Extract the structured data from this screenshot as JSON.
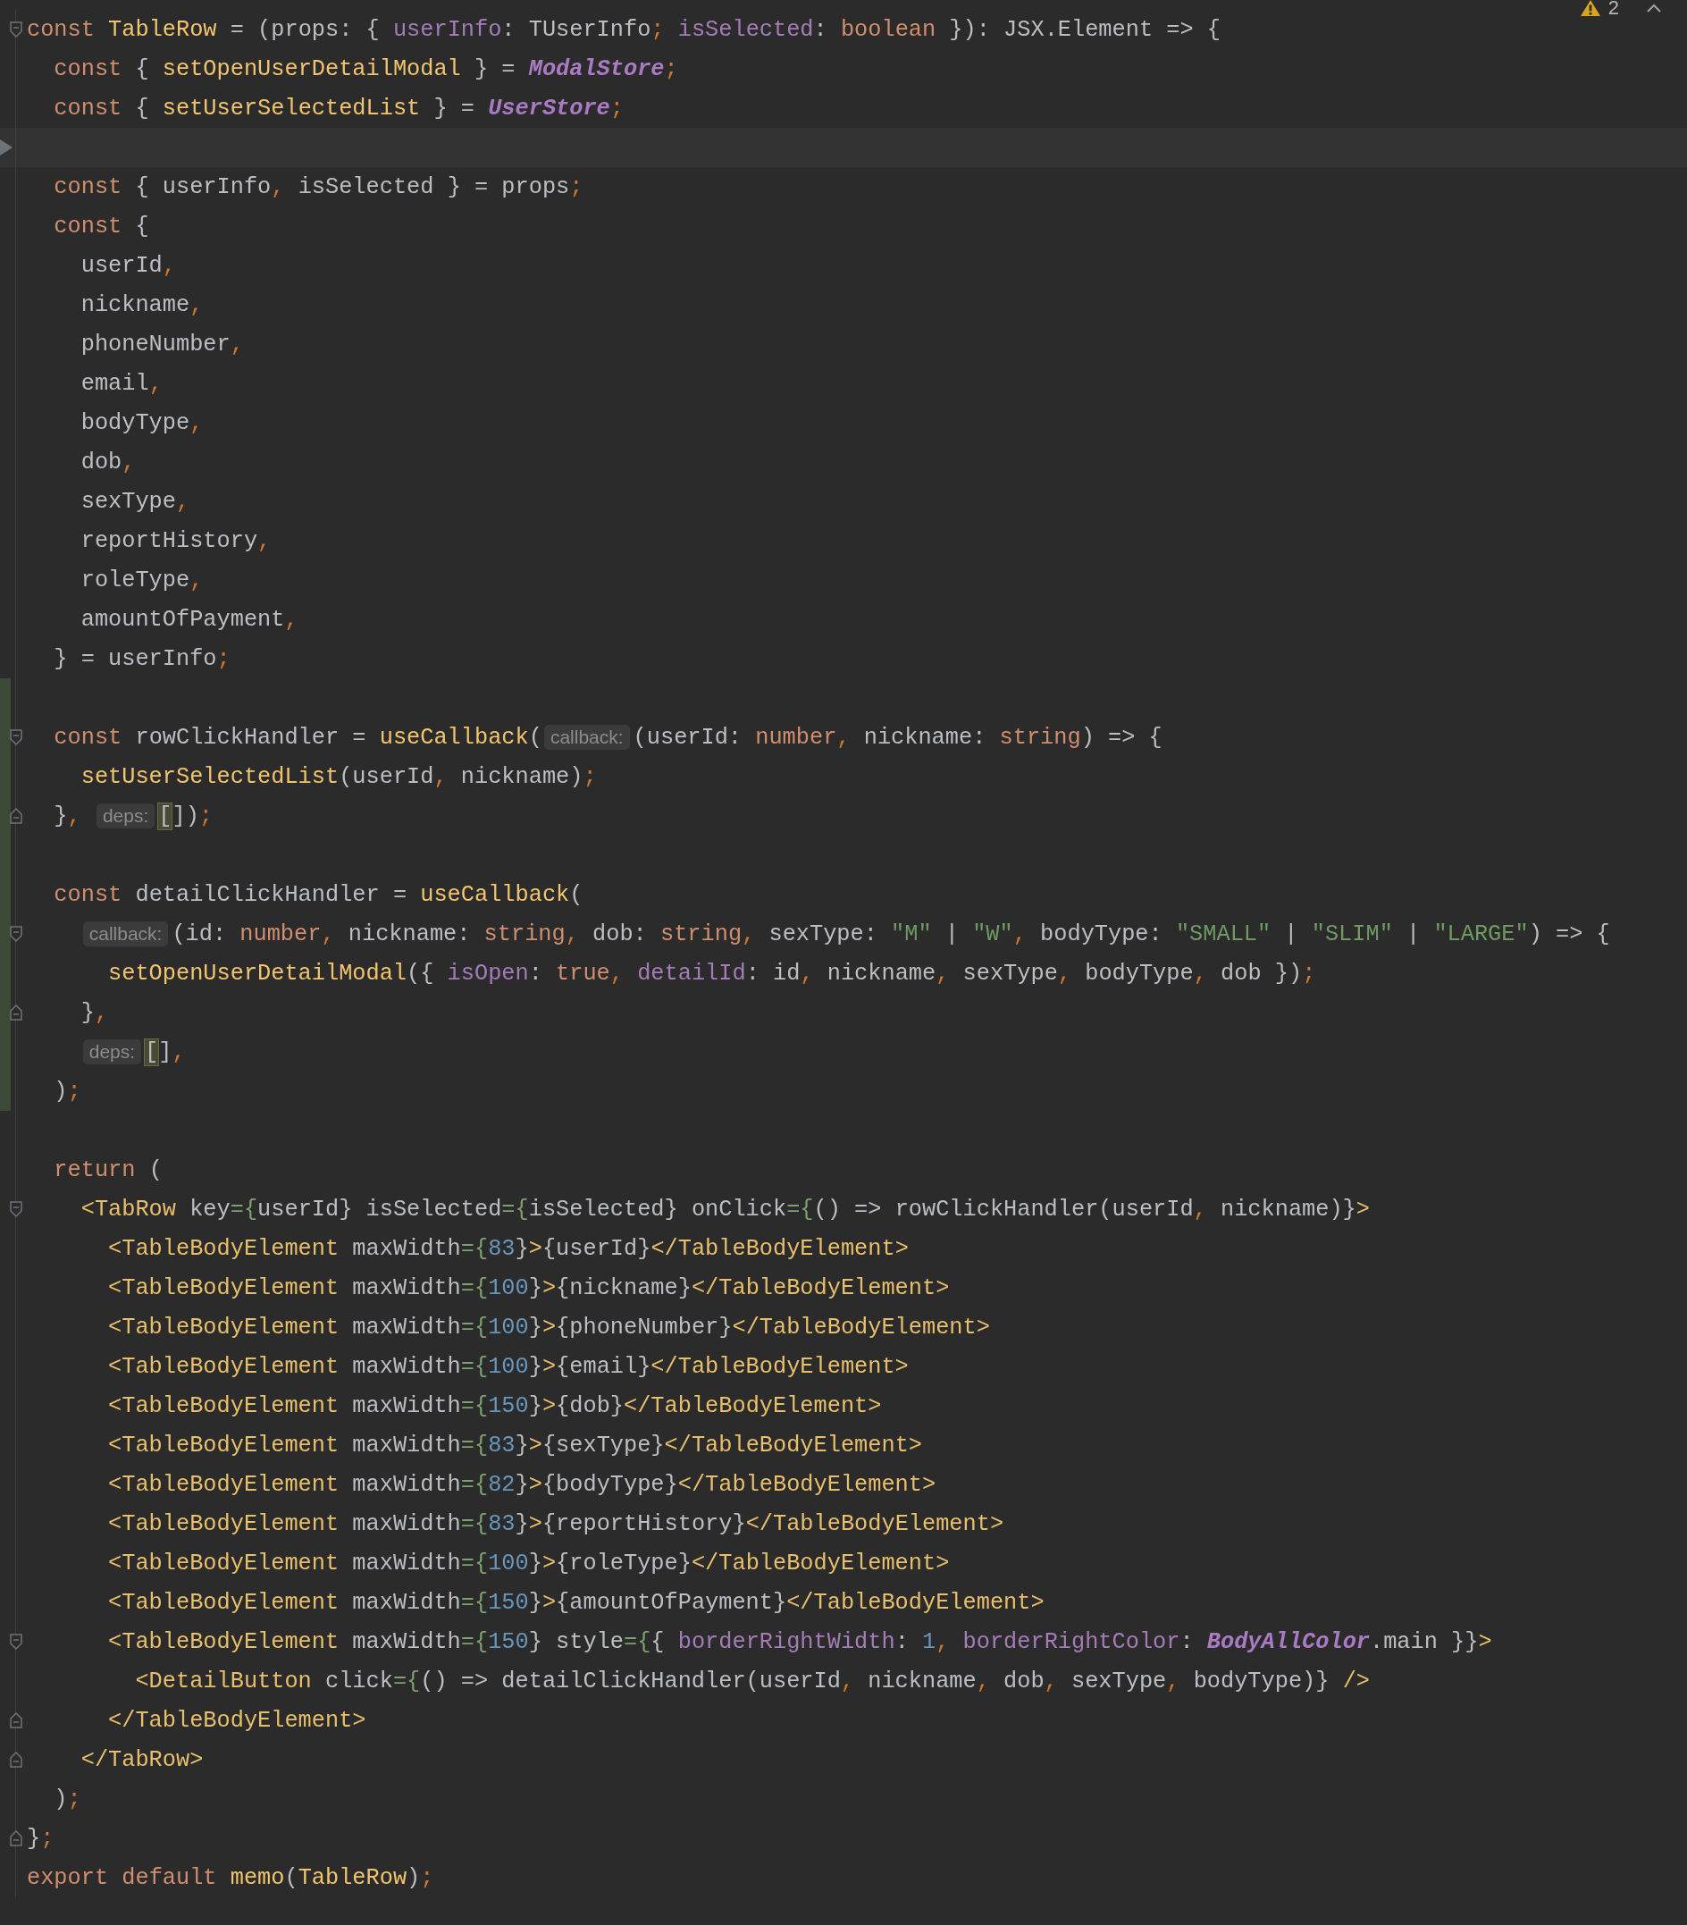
{
  "inspections": {
    "warning_count": "2"
  },
  "lines": [
    {
      "kind": "open",
      "current": false,
      "modified": false,
      "tokens": [
        {
          "kind": "keyword",
          "text": "const "
        },
        {
          "kind": "call",
          "text": "TableRow"
        },
        {
          "kind": "plain",
          "text": " = (props: { "
        },
        {
          "kind": "field",
          "text": "userInfo"
        },
        {
          "kind": "plain",
          "text": ": TUserInfo"
        },
        {
          "kind": "punct",
          "text": "; "
        },
        {
          "kind": "field",
          "text": "isSelected"
        },
        {
          "kind": "plain",
          "text": ": "
        },
        {
          "kind": "keyword",
          "text": "boolean"
        },
        {
          "kind": "plain",
          "text": " }): JSX.Element => {"
        }
      ],
      "children": [
        {
          "current": false,
          "modified": false,
          "tokens": [
            {
              "kind": "keyword",
              "text": "const "
            },
            {
              "kind": "plain",
              "text": "{ "
            },
            {
              "kind": "call",
              "text": "setOpenUserDetailModal"
            },
            {
              "kind": "plain",
              "text": " } = "
            },
            {
              "kind": "static",
              "text": "ModalStore"
            },
            {
              "kind": "punct",
              "text": ";"
            }
          ]
        },
        {
          "current": false,
          "modified": false,
          "tokens": [
            {
              "kind": "keyword",
              "text": "const "
            },
            {
              "kind": "plain",
              "text": "{ "
            },
            {
              "kind": "call",
              "text": "setUserSelectedList"
            },
            {
              "kind": "plain",
              "text": " } = "
            },
            {
              "kind": "static",
              "text": "UserStore"
            },
            {
              "kind": "punct",
              "text": ";"
            }
          ]
        },
        {
          "current": true,
          "modified": false
        },
        {
          "current": false,
          "modified": false,
          "tokens": [
            {
              "kind": "keyword",
              "text": "const "
            },
            {
              "kind": "plain",
              "text": "{ userInfo"
            },
            {
              "kind": "punct",
              "text": ", "
            },
            {
              "kind": "plain",
              "text": "isSelected } = props"
            },
            {
              "kind": "punct",
              "text": ";"
            }
          ]
        },
        {
          "current": false,
          "modified": false,
          "tokens": [
            {
              "kind": "keyword",
              "text": "const "
            },
            {
              "kind": "plain",
              "text": "{"
            }
          ],
          "children": [
            {
              "current": false,
              "modified": false,
              "tokens": [
                {
                  "kind": "plain",
                  "text": "userId"
                },
                {
                  "kind": "punct",
                  "text": ","
                }
              ]
            },
            {
              "current": false,
              "modified": false,
              "tokens": [
                {
                  "kind": "plain",
                  "text": "nickname"
                },
                {
                  "kind": "punct",
                  "text": ","
                }
              ]
            },
            {
              "current": false,
              "modified": false,
              "tokens": [
                {
                  "kind": "plain",
                  "text": "phoneNumber"
                },
                {
                  "kind": "punct",
                  "text": ","
                }
              ]
            },
            {
              "current": false,
              "modified": false,
              "tokens": [
                {
                  "kind": "plain",
                  "text": "email"
                },
                {
                  "kind": "punct",
                  "text": ","
                }
              ]
            },
            {
              "current": false,
              "modified": false,
              "tokens": [
                {
                  "kind": "plain",
                  "text": "bodyType"
                },
                {
                  "kind": "punct",
                  "text": ","
                }
              ]
            },
            {
              "current": false,
              "modified": false,
              "tokens": [
                {
                  "kind": "plain",
                  "text": "dob"
                },
                {
                  "kind": "punct",
                  "text": ","
                }
              ]
            },
            {
              "current": false,
              "modified": false,
              "tokens": [
                {
                  "kind": "plain",
                  "text": "sexType"
                },
                {
                  "kind": "punct",
                  "text": ","
                }
              ]
            },
            {
              "current": false,
              "modified": false,
              "tokens": [
                {
                  "kind": "plain",
                  "text": "reportHistory"
                },
                {
                  "kind": "punct",
                  "text": ","
                }
              ]
            },
            {
              "current": false,
              "modified": false,
              "tokens": [
                {
                  "kind": "plain",
                  "text": "roleType"
                },
                {
                  "kind": "punct",
                  "text": ","
                }
              ]
            },
            {
              "current": false,
              "modified": false,
              "tokens": [
                {
                  "kind": "plain",
                  "text": "amountOfPayment"
                },
                {
                  "kind": "punct",
                  "text": ","
                }
              ]
            }
          ]
        },
        {
          "current": false,
          "modified": false,
          "tokens": [
            {
              "kind": "plain",
              "text": "} = userInfo"
            },
            {
              "kind": "punct",
              "text": ";"
            }
          ]
        },
        {
          "current": false,
          "modified": true
        },
        {
          "kind": "open",
          "current": false,
          "modified": true,
          "tokens": [
            {
              "kind": "keyword",
              "text": "const "
            },
            {
              "kind": "plain",
              "text": "rowClickHandler = "
            },
            {
              "kind": "call",
              "text": "useCallback"
            },
            {
              "kind": "plain",
              "text": "("
            },
            {
              "kind": "hint",
              "text": "callback:"
            },
            {
              "kind": "plain",
              "text": "(userId: "
            },
            {
              "kind": "keyword",
              "text": "number"
            },
            {
              "kind": "punct",
              "text": ", "
            },
            {
              "kind": "plain",
              "text": "nickname: "
            },
            {
              "kind": "keyword",
              "text": "string"
            },
            {
              "kind": "plain",
              "text": ") => {"
            }
          ],
          "children": [
            {
              "current": false,
              "modified": true,
              "tokens": [
                {
                  "kind": "call",
                  "text": "setUserSelectedList"
                },
                {
                  "kind": "plain",
                  "text": "(userId"
                },
                {
                  "kind": "punct",
                  "text": ", "
                },
                {
                  "kind": "plain",
                  "text": "nickname)"
                },
                {
                  "kind": "punct",
                  "text": ";"
                }
              ]
            }
          ]
        },
        {
          "kind": "close",
          "current": false,
          "modified": true,
          "tokens": [
            {
              "kind": "plain",
              "text": "}"
            },
            {
              "kind": "punct",
              "text": ", "
            },
            {
              "kind": "hint",
              "text": "deps:"
            },
            {
              "kind": "match",
              "text": "["
            },
            {
              "kind": "plain",
              "text": "])"
            },
            {
              "kind": "punct",
              "text": ";"
            }
          ]
        },
        {
          "current": false,
          "modified": true
        },
        {
          "current": false,
          "modified": true,
          "tokens": [
            {
              "kind": "keyword",
              "text": "const "
            },
            {
              "kind": "plain",
              "text": "detailClickHandler = "
            },
            {
              "kind": "call",
              "text": "useCallback"
            },
            {
              "kind": "plain",
              "text": "("
            }
          ],
          "children": [
            {
              "kind": "open",
              "current": false,
              "modified": true,
              "tokens": [
                {
                  "kind": "hint",
                  "text": "callback:"
                },
                {
                  "kind": "plain",
                  "text": "(id: "
                },
                {
                  "kind": "keyword",
                  "text": "number"
                },
                {
                  "kind": "punct",
                  "text": ", "
                },
                {
                  "kind": "plain",
                  "text": "nickname: "
                },
                {
                  "kind": "keyword",
                  "text": "string"
                },
                {
                  "kind": "punct",
                  "text": ", "
                },
                {
                  "kind": "plain",
                  "text": "dob: "
                },
                {
                  "kind": "keyword",
                  "text": "string"
                },
                {
                  "kind": "punct",
                  "text": ", "
                },
                {
                  "kind": "plain",
                  "text": "sexType: "
                },
                {
                  "kind": "string",
                  "text": "\"M\""
                },
                {
                  "kind": "plain",
                  "text": " | "
                },
                {
                  "kind": "string",
                  "text": "\"W\""
                },
                {
                  "kind": "punct",
                  "text": ", "
                },
                {
                  "kind": "plain",
                  "text": "bodyType: "
                },
                {
                  "kind": "string",
                  "text": "\"SMALL\""
                },
                {
                  "kind": "plain",
                  "text": " | "
                },
                {
                  "kind": "string",
                  "text": "\"SLIM\""
                },
                {
                  "kind": "plain",
                  "text": " | "
                },
                {
                  "kind": "string",
                  "text": "\"LARGE\""
                },
                {
                  "kind": "plain",
                  "text": ") => {"
                }
              ],
              "children": [
                {
                  "current": false,
                  "modified": true,
                  "tokens": [
                    {
                      "kind": "call",
                      "text": "setOpenUserDetailModal"
                    },
                    {
                      "kind": "plain",
                      "text": "({ "
                    },
                    {
                      "kind": "field",
                      "text": "isOpen"
                    },
                    {
                      "kind": "plain",
                      "text": ": "
                    },
                    {
                      "kind": "keyword",
                      "text": "true"
                    },
                    {
                      "kind": "punct",
                      "text": ", "
                    },
                    {
                      "kind": "field",
                      "text": "detailId"
                    },
                    {
                      "kind": "plain",
                      "text": ": id"
                    },
                    {
                      "kind": "punct",
                      "text": ", "
                    },
                    {
                      "kind": "plain",
                      "text": "nickname"
                    },
                    {
                      "kind": "punct",
                      "text": ", "
                    },
                    {
                      "kind": "plain",
                      "text": "sexType"
                    },
                    {
                      "kind": "punct",
                      "text": ", "
                    },
                    {
                      "kind": "plain",
                      "text": "bodyType"
                    },
                    {
                      "kind": "punct",
                      "text": ", "
                    },
                    {
                      "kind": "plain",
                      "text": "dob })"
                    },
                    {
                      "kind": "punct",
                      "text": ";"
                    }
                  ]
                }
              ]
            },
            {
              "kind": "close",
              "current": false,
              "modified": true,
              "tokens": [
                {
                  "kind": "plain",
                  "text": "}"
                },
                {
                  "kind": "punct",
                  "text": ","
                }
              ]
            },
            {
              "current": false,
              "modified": true,
              "tokens": [
                {
                  "kind": "hint",
                  "text": "deps:"
                },
                {
                  "kind": "match",
                  "text": "["
                },
                {
                  "kind": "plain",
                  "text": "]"
                },
                {
                  "kind": "punct",
                  "text": ","
                }
              ]
            }
          ]
        },
        {
          "current": false,
          "modified": true,
          "tokens": [
            {
              "kind": "plain",
              "text": ")"
            },
            {
              "kind": "punct",
              "text": ";"
            }
          ]
        },
        {
          "current": false,
          "modified": false
        },
        {
          "current": false,
          "modified": false,
          "tokens": [
            {
              "kind": "keyword",
              "text": "return "
            },
            {
              "kind": "plain",
              "text": "("
            }
          ],
          "children": [
            {
              "kind": "open",
              "current": false,
              "modified": false,
              "tokens": [
                {
                  "kind": "tag",
                  "text": "<TabRow "
                },
                {
                  "kind": "plain",
                  "text": "key"
                },
                {
                  "kind": "equals",
                  "text": "={"
                },
                {
                  "kind": "plain",
                  "text": "userId} isSelected"
                },
                {
                  "kind": "equals",
                  "text": "={"
                },
                {
                  "kind": "plain",
                  "text": "isSelected} onClick"
                },
                {
                  "kind": "equals",
                  "text": "={"
                },
                {
                  "kind": "plain",
                  "text": "() => rowClickHandler(userId"
                },
                {
                  "kind": "punct",
                  "text": ", "
                },
                {
                  "kind": "plain",
                  "text": "nickname)}"
                },
                {
                  "kind": "tag",
                  "text": ">"
                }
              ],
              "children": [
                {
                  "current": false,
                  "modified": false,
                  "tokens": [
                    {
                      "kind": "tag",
                      "text": "<TableBodyElement "
                    },
                    {
                      "kind": "plain",
                      "text": "maxWidth"
                    },
                    {
                      "kind": "equals",
                      "text": "={"
                    },
                    {
                      "kind": "number",
                      "text": "83"
                    },
                    {
                      "kind": "plain",
                      "text": "}"
                    },
                    {
                      "kind": "tag",
                      "text": ">"
                    },
                    {
                      "kind": "plain",
                      "text": "{userId}"
                    },
                    {
                      "kind": "tag",
                      "text": "</TableBodyElement>"
                    }
                  ]
                },
                {
                  "current": false,
                  "modified": false,
                  "tokens": [
                    {
                      "kind": "tag",
                      "text": "<TableBodyElement "
                    },
                    {
                      "kind": "plain",
                      "text": "maxWidth"
                    },
                    {
                      "kind": "equals",
                      "text": "={"
                    },
                    {
                      "kind": "number",
                      "text": "100"
                    },
                    {
                      "kind": "plain",
                      "text": "}"
                    },
                    {
                      "kind": "tag",
                      "text": ">"
                    },
                    {
                      "kind": "plain",
                      "text": "{nickname}"
                    },
                    {
                      "kind": "tag",
                      "text": "</TableBodyElement>"
                    }
                  ]
                },
                {
                  "current": false,
                  "modified": false,
                  "tokens": [
                    {
                      "kind": "tag",
                      "text": "<TableBodyElement "
                    },
                    {
                      "kind": "plain",
                      "text": "maxWidth"
                    },
                    {
                      "kind": "equals",
                      "text": "={"
                    },
                    {
                      "kind": "number",
                      "text": "100"
                    },
                    {
                      "kind": "plain",
                      "text": "}"
                    },
                    {
                      "kind": "tag",
                      "text": ">"
                    },
                    {
                      "kind": "plain",
                      "text": "{phoneNumber}"
                    },
                    {
                      "kind": "tag",
                      "text": "</TableBodyElement>"
                    }
                  ]
                },
                {
                  "current": false,
                  "modified": false,
                  "tokens": [
                    {
                      "kind": "tag",
                      "text": "<TableBodyElement "
                    },
                    {
                      "kind": "plain",
                      "text": "maxWidth"
                    },
                    {
                      "kind": "equals",
                      "text": "={"
                    },
                    {
                      "kind": "number",
                      "text": "100"
                    },
                    {
                      "kind": "plain",
                      "text": "}"
                    },
                    {
                      "kind": "tag",
                      "text": ">"
                    },
                    {
                      "kind": "plain",
                      "text": "{email}"
                    },
                    {
                      "kind": "tag",
                      "text": "</TableBodyElement>"
                    }
                  ]
                },
                {
                  "current": false,
                  "modified": false,
                  "tokens": [
                    {
                      "kind": "tag",
                      "text": "<TableBodyElement "
                    },
                    {
                      "kind": "plain",
                      "text": "maxWidth"
                    },
                    {
                      "kind": "equals",
                      "text": "={"
                    },
                    {
                      "kind": "number",
                      "text": "150"
                    },
                    {
                      "kind": "plain",
                      "text": "}"
                    },
                    {
                      "kind": "tag",
                      "text": ">"
                    },
                    {
                      "kind": "plain",
                      "text": "{dob}"
                    },
                    {
                      "kind": "tag",
                      "text": "</TableBodyElement>"
                    }
                  ]
                },
                {
                  "current": false,
                  "modified": false,
                  "tokens": [
                    {
                      "kind": "tag",
                      "text": "<TableBodyElement "
                    },
                    {
                      "kind": "plain",
                      "text": "maxWidth"
                    },
                    {
                      "kind": "equals",
                      "text": "={"
                    },
                    {
                      "kind": "number",
                      "text": "83"
                    },
                    {
                      "kind": "plain",
                      "text": "}"
                    },
                    {
                      "kind": "tag",
                      "text": ">"
                    },
                    {
                      "kind": "plain",
                      "text": "{sexType}"
                    },
                    {
                      "kind": "tag",
                      "text": "</TableBodyElement>"
                    }
                  ]
                },
                {
                  "current": false,
                  "modified": false,
                  "tokens": [
                    {
                      "kind": "tag",
                      "text": "<TableBodyElement "
                    },
                    {
                      "kind": "plain",
                      "text": "maxWidth"
                    },
                    {
                      "kind": "equals",
                      "text": "={"
                    },
                    {
                      "kind": "number",
                      "text": "82"
                    },
                    {
                      "kind": "plain",
                      "text": "}"
                    },
                    {
                      "kind": "tag",
                      "text": ">"
                    },
                    {
                      "kind": "plain",
                      "text": "{bodyType}"
                    },
                    {
                      "kind": "tag",
                      "text": "</TableBodyElement>"
                    }
                  ]
                },
                {
                  "current": false,
                  "modified": false,
                  "tokens": [
                    {
                      "kind": "tag",
                      "text": "<TableBodyElement "
                    },
                    {
                      "kind": "plain",
                      "text": "maxWidth"
                    },
                    {
                      "kind": "equals",
                      "text": "={"
                    },
                    {
                      "kind": "number",
                      "text": "83"
                    },
                    {
                      "kind": "plain",
                      "text": "}"
                    },
                    {
                      "kind": "tag",
                      "text": ">"
                    },
                    {
                      "kind": "plain",
                      "text": "{reportHistory}"
                    },
                    {
                      "kind": "tag",
                      "text": "</TableBodyElement>"
                    }
                  ]
                },
                {
                  "current": false,
                  "modified": false,
                  "tokens": [
                    {
                      "kind": "tag",
                      "text": "<TableBodyElement "
                    },
                    {
                      "kind": "plain",
                      "text": "maxWidth"
                    },
                    {
                      "kind": "equals",
                      "text": "={"
                    },
                    {
                      "kind": "number",
                      "text": "100"
                    },
                    {
                      "kind": "plain",
                      "text": "}"
                    },
                    {
                      "kind": "tag",
                      "text": ">"
                    },
                    {
                      "kind": "plain",
                      "text": "{roleType}"
                    },
                    {
                      "kind": "tag",
                      "text": "</TableBodyElement>"
                    }
                  ]
                },
                {
                  "current": false,
                  "modified": false,
                  "tokens": [
                    {
                      "kind": "tag",
                      "text": "<TableBodyElement "
                    },
                    {
                      "kind": "plain",
                      "text": "maxWidth"
                    },
                    {
                      "kind": "equals",
                      "text": "={"
                    },
                    {
                      "kind": "number",
                      "text": "150"
                    },
                    {
                      "kind": "plain",
                      "text": "}"
                    },
                    {
                      "kind": "tag",
                      "text": ">"
                    },
                    {
                      "kind": "plain",
                      "text": "{amountOfPayment}"
                    },
                    {
                      "kind": "tag",
                      "text": "</TableBodyElement>"
                    }
                  ]
                },
                {
                  "kind": "open",
                  "current": false,
                  "modified": false,
                  "tokens": [
                    {
                      "kind": "tag",
                      "text": "<TableBodyElement "
                    },
                    {
                      "kind": "plain",
                      "text": "maxWidth"
                    },
                    {
                      "kind": "equals",
                      "text": "={"
                    },
                    {
                      "kind": "number",
                      "text": "150"
                    },
                    {
                      "kind": "plain",
                      "text": "} style"
                    },
                    {
                      "kind": "equals",
                      "text": "={"
                    },
                    {
                      "kind": "plain",
                      "text": "{ "
                    },
                    {
                      "kind": "field",
                      "text": "borderRightWidth"
                    },
                    {
                      "kind": "plain",
                      "text": ": "
                    },
                    {
                      "kind": "number",
                      "text": "1"
                    },
                    {
                      "kind": "punct",
                      "text": ", "
                    },
                    {
                      "kind": "field",
                      "text": "borderRightColor"
                    },
                    {
                      "kind": "plain",
                      "text": ": "
                    },
                    {
                      "kind": "static",
                      "text": "BodyAllColor"
                    },
                    {
                      "kind": "plain",
                      "text": ".main }}"
                    },
                    {
                      "kind": "tag",
                      "text": ">"
                    }
                  ],
                  "children": [
                    {
                      "current": false,
                      "modified": false,
                      "tokens": [
                        {
                          "kind": "tag",
                          "text": "<DetailButton "
                        },
                        {
                          "kind": "plain",
                          "text": "click"
                        },
                        {
                          "kind": "equals",
                          "text": "={"
                        },
                        {
                          "kind": "plain",
                          "text": "() => detailClickHandler(userId"
                        },
                        {
                          "kind": "punct",
                          "text": ", "
                        },
                        {
                          "kind": "plain",
                          "text": "nickname"
                        },
                        {
                          "kind": "punct",
                          "text": ", "
                        },
                        {
                          "kind": "plain",
                          "text": "dob"
                        },
                        {
                          "kind": "punct",
                          "text": ", "
                        },
                        {
                          "kind": "plain",
                          "text": "sexType"
                        },
                        {
                          "kind": "punct",
                          "text": ", "
                        },
                        {
                          "kind": "plain",
                          "text": "bodyType)} "
                        },
                        {
                          "kind": "tag",
                          "text": "/>"
                        }
                      ]
                    }
                  ]
                },
                {
                  "kind": "close",
                  "current": false,
                  "modified": false,
                  "tokens": [
                    {
                      "kind": "tag",
                      "text": "</TableBodyElement>"
                    }
                  ]
                }
              ]
            },
            {
              "kind": "close",
              "current": false,
              "modified": false,
              "tokens": [
                {
                  "kind": "tag",
                  "text": "</TabRow>"
                }
              ]
            }
          ]
        },
        {
          "current": false,
          "modified": false,
          "tokens": [
            {
              "kind": "plain",
              "text": ")"
            },
            {
              "kind": "punct",
              "text": ";"
            }
          ]
        }
      ]
    },
    {
      "kind": "close",
      "current": false,
      "modified": false,
      "tokens": [
        {
          "kind": "plain",
          "text": "}"
        },
        {
          "kind": "punct",
          "text": ";"
        }
      ]
    },
    {
      "current": false,
      "modified": false,
      "tokens": [
        {
          "kind": "keyword",
          "text": "export default "
        },
        {
          "kind": "call",
          "text": "memo"
        },
        {
          "kind": "plain",
          "text": "("
        },
        {
          "kind": "call",
          "text": "TableRow"
        },
        {
          "kind": "plain",
          "text": ")"
        },
        {
          "kind": "punct",
          "text": ";"
        }
      ]
    }
  ]
}
